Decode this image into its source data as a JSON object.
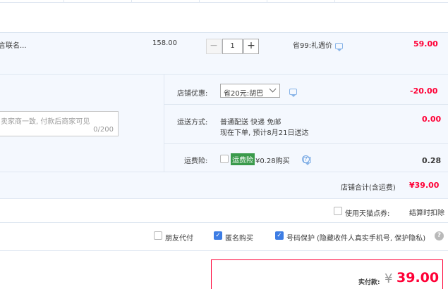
{
  "item": {
    "name": "言联名...",
    "price": "158.00",
    "minus": "−",
    "quantity": "1",
    "plus": "+",
    "promo": "省99:礼遇价",
    "subtotal": "59.00"
  },
  "shop": {
    "discount_label": "店铺优惠:",
    "discount_value": "省20元:胡巴",
    "discount_amount": "-20.00",
    "message_placeholder": "卖家商一致, 付款后商家可见",
    "message_count": "0/200",
    "shipping_label": "运送方式:",
    "shipping_method": "普通配送 快递 免邮",
    "shipping_note": "现在下单, 预计8月21日送达",
    "shipping_amount": "0.00",
    "insurance_label": "运费险:",
    "insurance_tag": "运费险",
    "insurance_price": "¥0.28购买",
    "insurance_amount": "0.28",
    "total_label": "店铺合计(含运费)",
    "total_value": "¥39.00"
  },
  "options": {
    "tmall_points": "使用天猫点券:",
    "deduct_note": "结算时扣除",
    "friend_pay": "朋友代付",
    "anonymous": "匿名购买",
    "number_protect": "号码保护",
    "number_protect_note": "(隐藏收件人真实手机号, 保护隐私)",
    "help": "?"
  },
  "pay": {
    "label": "实付款:",
    "currency": "¥",
    "amount": "39.00"
  }
}
